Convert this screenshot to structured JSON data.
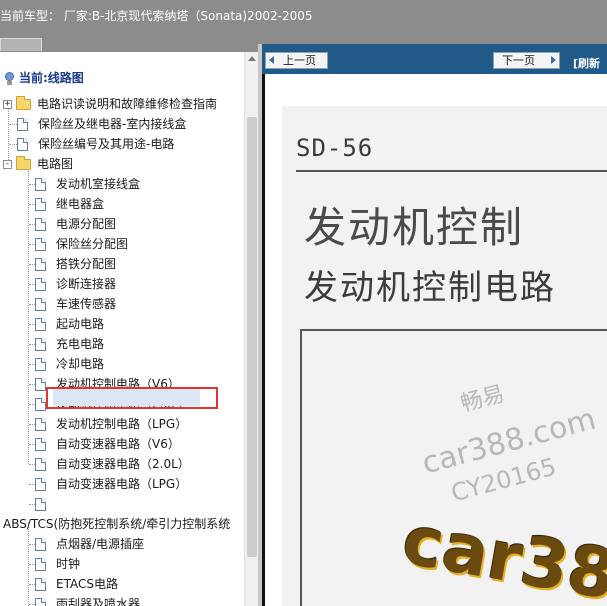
{
  "window": {
    "title": "当前车型： 厂家:B-北京现代索纳塔（Sonata)2002-2005"
  },
  "tree": {
    "current_label": "当前:线路图",
    "items": [
      {
        "label": "电路识读说明和故障维修检查指南",
        "type": "folder",
        "expand": "+"
      },
      {
        "label": "保险丝及继电器-室内接线盒",
        "type": "page"
      },
      {
        "label": "保险丝编号及其用途-电路",
        "type": "page"
      },
      {
        "label": "电路图",
        "type": "folder",
        "expand": "-"
      },
      {
        "label": "发动机室接线盒",
        "type": "page"
      },
      {
        "label": "继电器盒",
        "type": "page"
      },
      {
        "label": "电源分配图",
        "type": "page"
      },
      {
        "label": "保险丝分配图",
        "type": "page"
      },
      {
        "label": "搭铁分配图",
        "type": "page"
      },
      {
        "label": "诊断连接器",
        "type": "page"
      },
      {
        "label": "车速传感器",
        "type": "page"
      },
      {
        "label": "起动电路",
        "type": "page"
      },
      {
        "label": "充电电路",
        "type": "page"
      },
      {
        "label": "冷却电路",
        "type": "page"
      },
      {
        "label": "发动机控制电路（V6）",
        "type": "page"
      },
      {
        "label": "发动机控制电路（2.0L）",
        "type": "page",
        "selected": true
      },
      {
        "label": "发动机控制电路（LPG）",
        "type": "page"
      },
      {
        "label": "自动变速器电路（V6）",
        "type": "page"
      },
      {
        "label": "自动变速器电路（2.0L）",
        "type": "page"
      },
      {
        "label": "自动变速器电路（LPG）",
        "type": "page"
      },
      {
        "label": "",
        "type": "page"
      },
      {
        "label": "ABS/TCS(防抱死控制系统/牵引力控制系统",
        "type": "text"
      },
      {
        "label": "点烟器/电源插座",
        "type": "page"
      },
      {
        "label": "时钟",
        "type": "page"
      },
      {
        "label": "ETACS电路",
        "type": "page"
      },
      {
        "label": "雨刮器及喷水器",
        "type": "page"
      }
    ]
  },
  "nav": {
    "prev_label": "上一页",
    "next_label": "下一页",
    "refresh_label": "[刷新"
  },
  "document": {
    "code": "SD-56",
    "title_line1": "发动机控制",
    "title_line2": "发动机控制电路",
    "watermark_1": "畅易",
    "watermark_2": "car388.com",
    "watermark_3": "CY20165",
    "watermark_big": "car38"
  }
}
